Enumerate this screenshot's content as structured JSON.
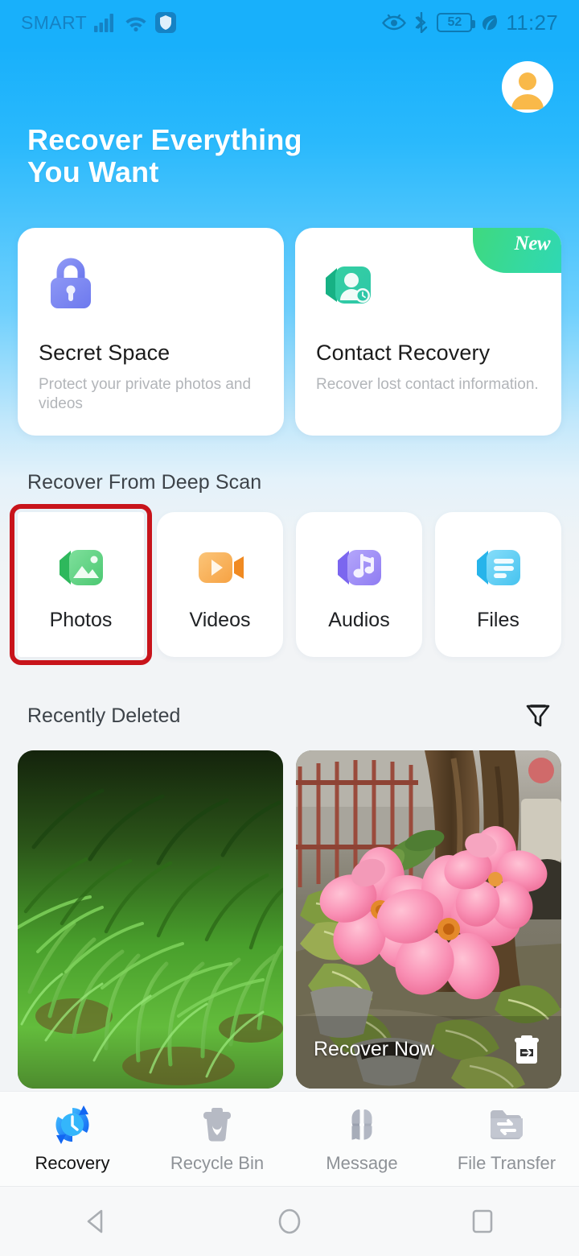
{
  "status_bar": {
    "carrier": "SMART",
    "battery_level": "52",
    "time": "11:27",
    "icons": [
      "signal-bars-icon",
      "wifi-icon",
      "vpn-shield-icon",
      "eye-comfort-icon",
      "bluetooth-icon",
      "battery-icon",
      "power-saving-leaf-icon"
    ]
  },
  "header": {
    "title_line1": "Recover Everything",
    "title_line2": "You Want",
    "avatar_icon": "user-avatar-icon",
    "accent_color": "#18b0fb"
  },
  "feature_cards": [
    {
      "title": "Secret Space",
      "subtitle": "Protect your private photos and videos",
      "icon": "lock-icon",
      "icon_color": "#7b86f0",
      "badge": ""
    },
    {
      "title": "Contact Recovery",
      "subtitle": "Recover lost contact information.",
      "icon": "contact-recovery-icon",
      "icon_color": "#2fc9a0",
      "badge": "New"
    }
  ],
  "deep_scan": {
    "section_title": "Recover From Deep Scan",
    "tiles": [
      {
        "label": "Photos",
        "icon": "photos-icon",
        "color": "#56d07b",
        "highlighted": true
      },
      {
        "label": "Videos",
        "icon": "videos-icon",
        "color": "#f7b35c",
        "highlighted": false
      },
      {
        "label": "Audios",
        "icon": "audios-icon",
        "color": "#9e8cf5",
        "highlighted": false
      },
      {
        "label": "Files",
        "icon": "files-icon",
        "color": "#57cdf5",
        "highlighted": false
      }
    ]
  },
  "recently_deleted": {
    "section_title": "Recently Deleted",
    "filter_icon": "filter-funnel-icon",
    "items": [
      {
        "alt": "grass-photo",
        "overlay_label": "",
        "overlay_icon": ""
      },
      {
        "alt": "pink-flowers-photo",
        "overlay_label": "Recover Now",
        "overlay_icon": "restore-trash-icon"
      }
    ]
  },
  "tab_bar": {
    "active_index": 0,
    "tabs": [
      {
        "label": "Recovery",
        "icon": "recovery-clock-icon"
      },
      {
        "label": "Recycle Bin",
        "icon": "recycle-bin-icon"
      },
      {
        "label": "Message",
        "icon": "message-clover-icon"
      },
      {
        "label": "File Transfer",
        "icon": "file-transfer-icon"
      }
    ]
  },
  "system_nav": {
    "buttons": [
      {
        "icon": "back-triangle-icon"
      },
      {
        "icon": "home-circle-icon"
      },
      {
        "icon": "recents-square-icon"
      }
    ]
  }
}
